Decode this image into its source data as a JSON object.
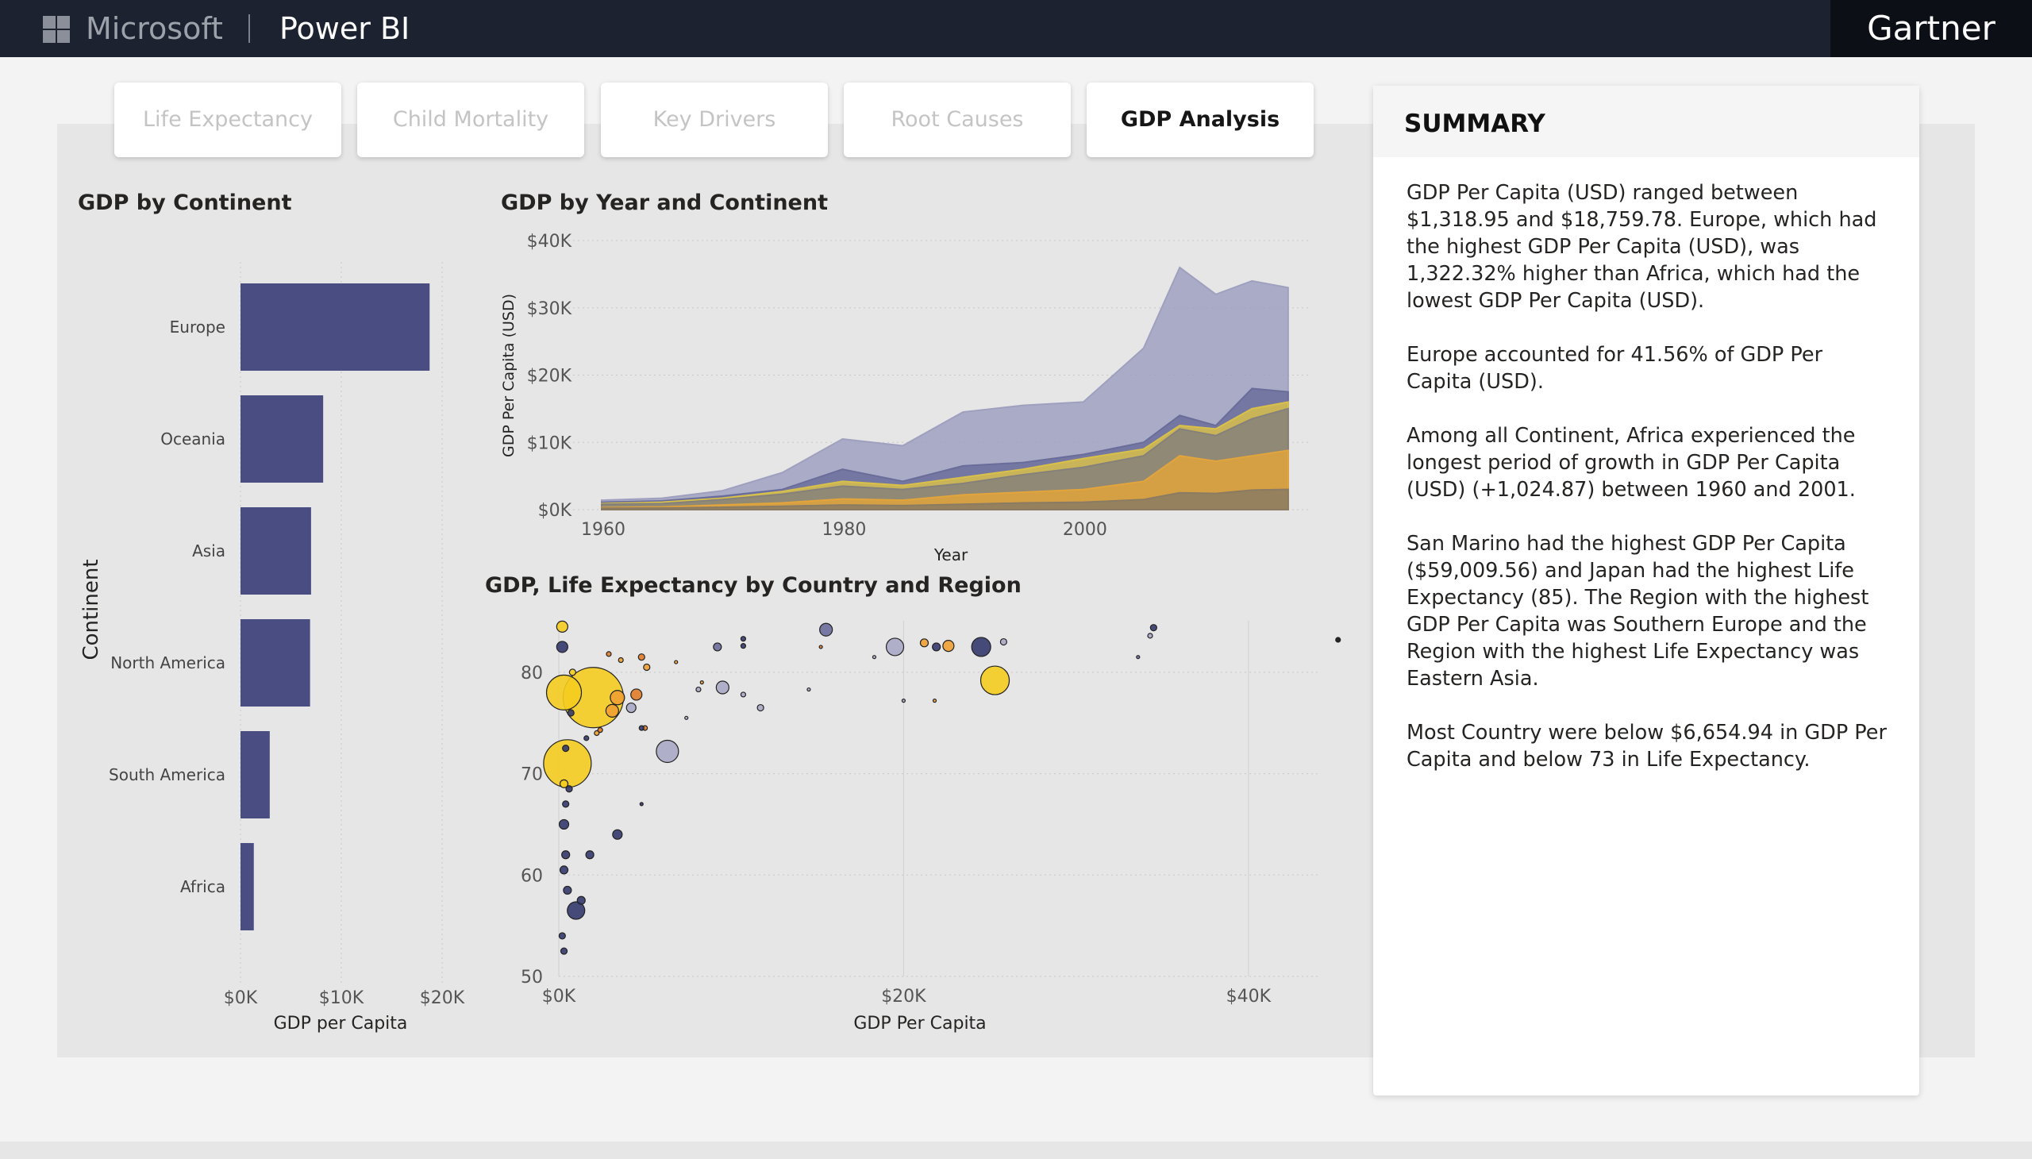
{
  "header": {
    "brand": "Microsoft",
    "product": "Power BI",
    "partner": "Gartner",
    "logo_icon": "microsoft-grid-icon"
  },
  "tabs": [
    {
      "label": "Life Expectancy",
      "active": false
    },
    {
      "label": "Child Mortality",
      "active": false
    },
    {
      "label": "Key Drivers",
      "active": false
    },
    {
      "label": "Root Causes",
      "active": false
    },
    {
      "label": "GDP Analysis",
      "active": true
    }
  ],
  "colors": {
    "bar": "#4a4d82",
    "summary_header_bg": "#f5f5f5",
    "canvas_bg": "#e6e6e6"
  },
  "visuals": {
    "bar_title": "GDP by Continent",
    "area_title": "GDP by Year and Continent",
    "scatter_title": "GDP, Life Expectancy by Country and Region"
  },
  "chart_data": [
    {
      "type": "bar",
      "orientation": "horizontal",
      "title": "GDP by Continent",
      "xlabel": "GDP per Capita",
      "ylabel": "Continent",
      "categories": [
        "Europe",
        "Oceania",
        "Asia",
        "North America",
        "South America",
        "Africa"
      ],
      "values": [
        18759.78,
        8200,
        7000,
        6900,
        2900,
        1318.95
      ],
      "xlim": [
        0,
        20000
      ],
      "x_ticks": [
        "$0K",
        "$10K",
        "$20K"
      ],
      "x_tick_values": [
        0,
        10000,
        20000
      ],
      "grid": true
    },
    {
      "type": "area",
      "title": "GDP by Year and Continent",
      "xlabel": "Year",
      "ylabel": "GDP Per Capita (USD)",
      "x": [
        1960,
        1965,
        1970,
        1975,
        1980,
        1985,
        1990,
        1995,
        2000,
        2005,
        2008,
        2011,
        2014,
        2017
      ],
      "xlim": [
        1960,
        2018
      ],
      "ylim": [
        0,
        40000
      ],
      "x_ticks": [
        "1960",
        "1980",
        "2000"
      ],
      "x_tick_values": [
        1960,
        1980,
        2000
      ],
      "y_ticks": [
        "$0K",
        "$10K",
        "$20K",
        "$30K",
        "$40K"
      ],
      "y_tick_values": [
        0,
        10000,
        20000,
        30000,
        40000
      ],
      "series": [
        {
          "color": "#9fa0bf",
          "values": [
            1400,
            1700,
            2800,
            5500,
            10500,
            9500,
            14500,
            15500,
            16000,
            24000,
            36000,
            32000,
            34000,
            33000
          ]
        },
        {
          "color": "#6a6d9a",
          "values": [
            1100,
            1300,
            2000,
            3000,
            6000,
            4200,
            6500,
            7000,
            8200,
            10000,
            14000,
            12500,
            18000,
            17500
          ]
        },
        {
          "color": "#d8c04a",
          "values": [
            900,
            1100,
            1700,
            2700,
            4200,
            3600,
            4800,
            6000,
            7600,
            9000,
            12500,
            12000,
            15000,
            16000
          ]
        },
        {
          "color": "#85817a",
          "values": [
            800,
            900,
            1500,
            2300,
            3500,
            3000,
            3900,
            5200,
            6300,
            8000,
            12000,
            11000,
            13500,
            15000
          ]
        },
        {
          "color": "#e2a43c",
          "values": [
            300,
            400,
            700,
            1000,
            1600,
            1400,
            2200,
            2600,
            3000,
            4200,
            8000,
            7200,
            8000,
            8800
          ]
        },
        {
          "color": "#8a7b62",
          "values": [
            200,
            250,
            350,
            500,
            700,
            600,
            800,
            1000,
            1100,
            1500,
            2500,
            2400,
            2900,
            3000
          ]
        }
      ],
      "grid": true
    },
    {
      "type": "scatter",
      "title": "GDP, Life Expectancy by Country and Region",
      "xlabel": "GDP Per Capita",
      "ylabel": "",
      "xlim": [
        0,
        50000
      ],
      "ylim": [
        50,
        85
      ],
      "x_ticks": [
        "$0K",
        "$20K",
        "$40K"
      ],
      "x_tick_values": [
        0,
        20000,
        40000
      ],
      "y_ticks": [
        "50",
        "60",
        "70",
        "80"
      ],
      "y_tick_values": [
        50,
        60,
        70,
        80
      ],
      "points": [
        {
          "x": 2000,
          "y": 77.5,
          "r": 38,
          "c": "#f5cc1f"
        },
        {
          "x": 500,
          "y": 71,
          "r": 30,
          "c": "#f5cc1f"
        },
        {
          "x": 300,
          "y": 78,
          "r": 22,
          "c": "#f5cc1f"
        },
        {
          "x": 25300,
          "y": 79.2,
          "r": 18,
          "c": "#f5cc1f"
        },
        {
          "x": 6300,
          "y": 72.2,
          "r": 14,
          "c": "#a8a9c6"
        },
        {
          "x": 24500,
          "y": 82.5,
          "r": 12,
          "c": "#34386b"
        },
        {
          "x": 1000,
          "y": 56.5,
          "r": 11,
          "c": "#34386b"
        },
        {
          "x": 19500,
          "y": 82.5,
          "r": 11,
          "c": "#a8a9c6"
        },
        {
          "x": 15500,
          "y": 84.2,
          "r": 8,
          "c": "#6a6d9a"
        },
        {
          "x": 9500,
          "y": 78.5,
          "r": 8,
          "c": "#a8a9c6"
        },
        {
          "x": 3400,
          "y": 77.5,
          "r": 9,
          "c": "#f0a033"
        },
        {
          "x": 4500,
          "y": 77.8,
          "r": 7,
          "c": "#e07b28"
        },
        {
          "x": 3100,
          "y": 76.2,
          "r": 8,
          "c": "#f0a033"
        },
        {
          "x": 4200,
          "y": 76.5,
          "r": 6,
          "c": "#a8a9c6"
        },
        {
          "x": 200,
          "y": 84.5,
          "r": 7,
          "c": "#f5cc1f"
        },
        {
          "x": 200,
          "y": 82.5,
          "r": 7,
          "c": "#34386b"
        },
        {
          "x": 3400,
          "y": 64,
          "r": 6,
          "c": "#34386b"
        },
        {
          "x": 1800,
          "y": 62,
          "r": 5,
          "c": "#34386b"
        },
        {
          "x": 1300,
          "y": 57.5,
          "r": 5,
          "c": "#34386b"
        },
        {
          "x": 300,
          "y": 65,
          "r": 6,
          "c": "#34386b"
        },
        {
          "x": 400,
          "y": 62,
          "r": 5,
          "c": "#34386b"
        },
        {
          "x": 300,
          "y": 60.5,
          "r": 5,
          "c": "#34386b"
        },
        {
          "x": 500,
          "y": 58.5,
          "r": 5,
          "c": "#34386b"
        },
        {
          "x": 400,
          "y": 67,
          "r": 4,
          "c": "#34386b"
        },
        {
          "x": 200,
          "y": 54,
          "r": 4,
          "c": "#34386b"
        },
        {
          "x": 300,
          "y": 52.5,
          "r": 4,
          "c": "#34386b"
        },
        {
          "x": 22600,
          "y": 82.6,
          "r": 7,
          "c": "#f0a033"
        },
        {
          "x": 21200,
          "y": 82.9,
          "r": 5,
          "c": "#f0a033"
        },
        {
          "x": 21900,
          "y": 82.5,
          "r": 5,
          "c": "#34386b"
        },
        {
          "x": 25800,
          "y": 83,
          "r": 4,
          "c": "#a8a9c6"
        },
        {
          "x": 34500,
          "y": 84.4,
          "r": 4,
          "c": "#34386b"
        },
        {
          "x": 34300,
          "y": 83.6,
          "r": 3,
          "c": "#a8a9c6"
        },
        {
          "x": 45200,
          "y": 83.2,
          "r": 3,
          "c": "#111111"
        },
        {
          "x": 33600,
          "y": 81.5,
          "r": 2,
          "c": "#6a6d9a"
        },
        {
          "x": 11700,
          "y": 76.5,
          "r": 4,
          "c": "#a8a9c6"
        },
        {
          "x": 10700,
          "y": 77.8,
          "r": 3,
          "c": "#a8a9c6"
        },
        {
          "x": 9200,
          "y": 82.5,
          "r": 5,
          "c": "#6a6d9a"
        },
        {
          "x": 10700,
          "y": 82.6,
          "r": 3,
          "c": "#34386b"
        },
        {
          "x": 10700,
          "y": 83.3,
          "r": 3,
          "c": "#34386b"
        },
        {
          "x": 5100,
          "y": 80.5,
          "r": 4,
          "c": "#f0a033"
        },
        {
          "x": 4800,
          "y": 81.5,
          "r": 4,
          "c": "#e07b28"
        },
        {
          "x": 5000,
          "y": 74.5,
          "r": 3,
          "c": "#e07b28"
        },
        {
          "x": 2400,
          "y": 74.3,
          "r": 3,
          "c": "#e07b28"
        },
        {
          "x": 1600,
          "y": 73.5,
          "r": 3,
          "c": "#34386b"
        },
        {
          "x": 8100,
          "y": 78.3,
          "r": 3,
          "c": "#a8a9c6"
        },
        {
          "x": 7400,
          "y": 75.5,
          "r": 2,
          "c": "#a8a9c6"
        },
        {
          "x": 14500,
          "y": 78.3,
          "r": 2,
          "c": "#a8a9c6"
        },
        {
          "x": 18300,
          "y": 81.5,
          "r": 2,
          "c": "#a8a9c6"
        },
        {
          "x": 20000,
          "y": 77.2,
          "r": 2,
          "c": "#a8a9c6"
        },
        {
          "x": 21800,
          "y": 77.2,
          "r": 2,
          "c": "#f0a033"
        },
        {
          "x": 15200,
          "y": 82.5,
          "r": 2,
          "c": "#e07b28"
        },
        {
          "x": 3600,
          "y": 81.2,
          "r": 3,
          "c": "#f0a033"
        },
        {
          "x": 2900,
          "y": 81.8,
          "r": 3,
          "c": "#e07b28"
        },
        {
          "x": 4800,
          "y": 74.5,
          "r": 3,
          "c": "#34386b"
        },
        {
          "x": 6800,
          "y": 81,
          "r": 2,
          "c": "#f0a033"
        },
        {
          "x": 8300,
          "y": 79,
          "r": 2,
          "c": "#f0a033"
        },
        {
          "x": 4800,
          "y": 67,
          "r": 2,
          "c": "#34386b"
        },
        {
          "x": 2200,
          "y": 74,
          "r": 3,
          "c": "#f0a033"
        },
        {
          "x": 700,
          "y": 76,
          "r": 4,
          "c": "#34386b"
        },
        {
          "x": 800,
          "y": 80,
          "r": 4,
          "c": "#f5cc1f"
        },
        {
          "x": 300,
          "y": 69,
          "r": 5,
          "c": "#f5cc1f"
        },
        {
          "x": 600,
          "y": 68.5,
          "r": 4,
          "c": "#34386b"
        },
        {
          "x": 400,
          "y": 72.5,
          "r": 4,
          "c": "#34386b"
        }
      ],
      "grid": true
    }
  ],
  "summary": {
    "title": "SUMMARY",
    "paragraphs": [
      "GDP Per Capita (USD) ranged between $1,318.95 and $18,759.78. Europe, which had the highest GDP Per Capita (USD), was 1,322.32% higher than Africa, which had the lowest GDP Per Capita (USD).",
      "Europe accounted for 41.56% of GDP Per Capita (USD).",
      "Among all Continent, Africa experienced the longest period of growth in GDP Per Capita (USD) (+1,024.87) between 1960 and 2001.",
      "San Marino had the highest GDP Per Capita ($59,009.56) and Japan had the highest Life Expectancy (85). The Region with the highest GDP Per Capita was Southern Europe and the Region with the highest Life Expectancy was Eastern Asia.",
      "Most Country were below $6,654.94 in GDP Per Capita and below 73 in Life Expectancy."
    ]
  }
}
